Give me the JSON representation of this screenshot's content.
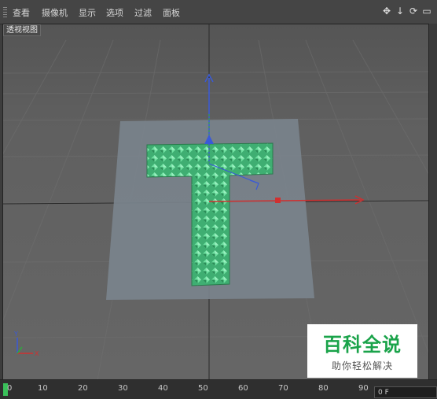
{
  "menu": {
    "items": [
      "查看",
      "摄像机",
      "显示",
      "选项",
      "过滤",
      "面板"
    ]
  },
  "nav_icons": [
    "move-view-icon",
    "dolly-view-icon",
    "rotate-view-icon",
    "maximize-view-icon"
  ],
  "viewport": {
    "label": "透视视图"
  },
  "timeline": {
    "ticks": [
      "0",
      "10",
      "20",
      "30",
      "40",
      "50",
      "60",
      "70",
      "80",
      "90"
    ],
    "frame_value": "0 F"
  },
  "watermark": {
    "title": "百科全说",
    "subtitle": "助你轻松解决"
  },
  "colors": {
    "x_axis": "#d03030",
    "y_axis": "#3a5ad8",
    "z_axis": "#2fa83f",
    "object": "#4fc88a",
    "plane": "#7a838c"
  }
}
